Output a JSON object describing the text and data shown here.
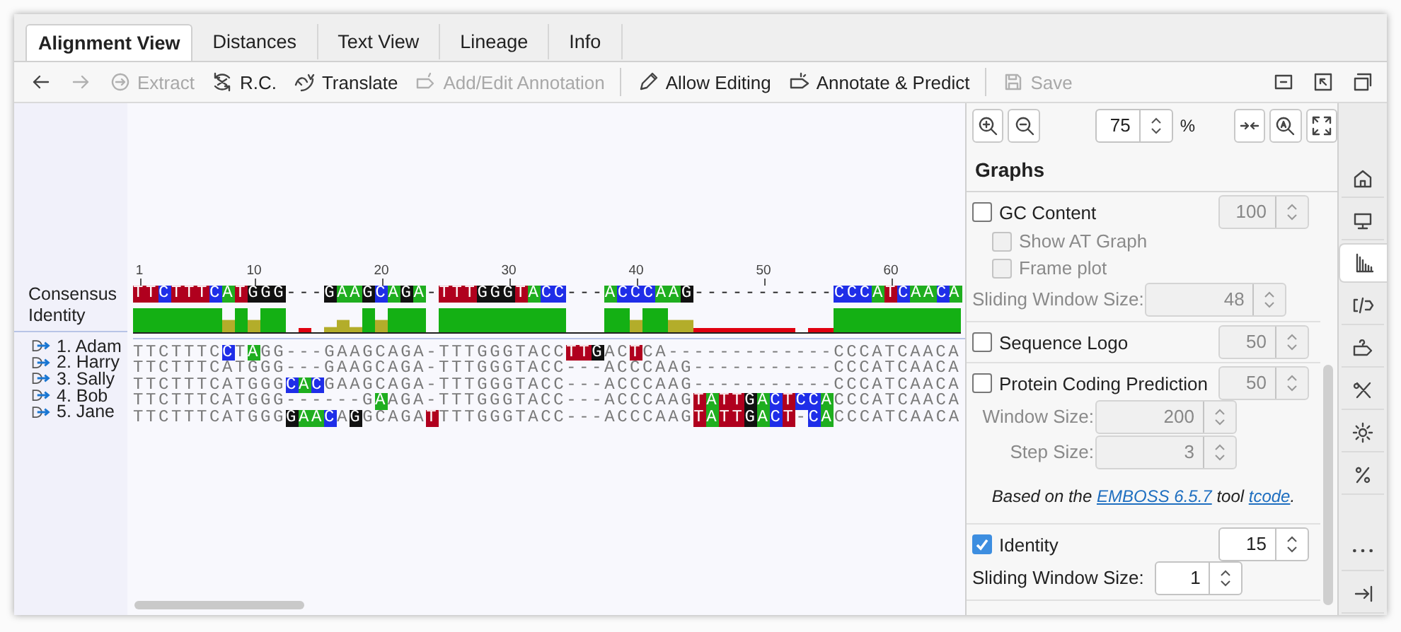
{
  "tabs": [
    {
      "label": "Alignment View",
      "selected": true
    },
    {
      "label": "Distances",
      "selected": false
    },
    {
      "label": "Text View",
      "selected": false
    },
    {
      "label": "Lineage",
      "selected": false
    },
    {
      "label": "Info",
      "selected": false
    }
  ],
  "toolbar": [
    {
      "kind": "back",
      "disabled": false
    },
    {
      "kind": "forward",
      "disabled": true
    },
    {
      "kind": "extract",
      "label": "Extract",
      "disabled": true
    },
    {
      "kind": "rc",
      "label": "R.C.",
      "disabled": false
    },
    {
      "kind": "translate",
      "label": "Translate",
      "disabled": false
    },
    {
      "kind": "annotation",
      "label": "Add/Edit Annotation",
      "disabled": true
    },
    {
      "kind": "separator"
    },
    {
      "kind": "edit",
      "label": "Allow Editing",
      "disabled": false
    },
    {
      "kind": "predict",
      "label": "Annotate & Predict",
      "disabled": false
    },
    {
      "kind": "separator"
    },
    {
      "kind": "save",
      "label": "Save",
      "disabled": true
    }
  ],
  "toolbar_right": [
    {
      "kind": "collapse"
    },
    {
      "kind": "popout"
    },
    {
      "kind": "windows"
    }
  ],
  "alignment": {
    "ruler": [
      "1",
      "10",
      "20",
      "30",
      "40",
      "50",
      "60"
    ],
    "consensus_label": "Consensus",
    "identity_label": "Identity",
    "consensus": [
      {
        "text": "TT",
        "color": "#b0001e"
      },
      {
        "text": "C",
        "color": "#1f2ee8"
      },
      {
        "text": "TTT",
        "color": "#b0001e"
      },
      {
        "text": "C",
        "color": "#1f2ee8"
      },
      {
        "text": "A",
        "color": "#1fae1f"
      },
      {
        "text": "T",
        "color": "#b0001e"
      },
      {
        "text": "GGG",
        "color": "#111111"
      },
      {
        "text": "---"
      },
      {
        "text": "G",
        "color": "#111111"
      },
      {
        "text": "AA",
        "color": "#1fae1f"
      },
      {
        "text": "G",
        "color": "#111111"
      },
      {
        "text": "C",
        "color": "#1f2ee8"
      },
      {
        "text": "A",
        "color": "#1fae1f"
      },
      {
        "text": "G",
        "color": "#111111"
      },
      {
        "text": "A",
        "color": "#1fae1f"
      },
      {
        "text": "-"
      },
      {
        "text": "TTT",
        "color": "#b0001e"
      },
      {
        "text": "GGG",
        "color": "#111111"
      },
      {
        "text": "T",
        "color": "#b0001e"
      },
      {
        "text": "A",
        "color": "#1fae1f"
      },
      {
        "text": "CC",
        "color": "#1f2ee8"
      },
      {
        "text": "---"
      },
      {
        "text": "A",
        "color": "#1fae1f"
      },
      {
        "text": "CCC",
        "color": "#1f2ee8"
      },
      {
        "text": "AA",
        "color": "#1fae1f"
      },
      {
        "text": "G",
        "color": "#111111"
      },
      {
        "text": "-----------"
      },
      {
        "text": "CCC",
        "color": "#1f2ee8"
      },
      {
        "text": "A",
        "color": "#1fae1f"
      },
      {
        "text": "T",
        "color": "#b0001e"
      },
      {
        "text": "C",
        "color": "#1f2ee8"
      },
      {
        "text": "AA",
        "color": "#1fae1f"
      },
      {
        "text": "C",
        "color": "#1f2ee8"
      },
      {
        "text": "A",
        "color": "#1fae1f"
      }
    ],
    "sequences": [
      {
        "name": "1. Adam",
        "segments": [
          {
            "text": "TTCTTTC"
          },
          {
            "text": "C",
            "color": "#1f2ee8"
          },
          {
            "text": "T"
          },
          {
            "text": "A",
            "color": "#1fae1f"
          },
          {
            "text": "GG---GAAGCAGA-TTTGGGTACC"
          },
          {
            "text": "TT",
            "color": "#b0001e"
          },
          {
            "text": "G",
            "color": "#111111"
          },
          {
            "text": "AC"
          },
          {
            "text": "T",
            "color": "#b0001e"
          },
          {
            "text": "CA-------------CCCATCAACA"
          }
        ]
      },
      {
        "name": "2. Harry",
        "segments": [
          {
            "text": "TTCTTTCATGGG---GAAGCAGA-TTTGGGTACC---ACCCAAG-----------CCCATCAACA"
          }
        ]
      },
      {
        "name": "3. Sally",
        "segments": [
          {
            "text": "TTCTTTCATGGG"
          },
          {
            "text": "C",
            "color": "#1f2ee8"
          },
          {
            "text": "A",
            "color": "#1fae1f"
          },
          {
            "text": "C",
            "color": "#1f2ee8"
          },
          {
            "text": "GAAGCAGA-TTTGGGTACC---ACCCAAG-----------CCCATCAACA"
          }
        ]
      },
      {
        "name": "4. Bob",
        "segments": [
          {
            "text": "TTCTTTCATGGG------G"
          },
          {
            "text": "A",
            "color": "#1fae1f"
          },
          {
            "text": "AGA-TTTGGGTACC---ACCCAAG"
          },
          {
            "text": "T",
            "color": "#b0001e"
          },
          {
            "text": "A",
            "color": "#1fae1f"
          },
          {
            "text": "TT",
            "color": "#b0001e"
          },
          {
            "text": "G",
            "color": "#111111"
          },
          {
            "text": "A",
            "color": "#1fae1f"
          },
          {
            "text": "C",
            "color": "#1f2ee8"
          },
          {
            "text": "T",
            "color": "#b0001e"
          },
          {
            "text": "CC",
            "color": "#1f2ee8"
          },
          {
            "text": "A",
            "color": "#1fae1f"
          },
          {
            "text": "CCCATCAACA"
          }
        ]
      },
      {
        "name": "5. Jane",
        "segments": [
          {
            "text": "TTCTTTCATGGG"
          },
          {
            "text": "G",
            "color": "#111111"
          },
          {
            "text": "AA",
            "color": "#1fae1f"
          },
          {
            "text": "C",
            "color": "#1f2ee8"
          },
          {
            "text": "A"
          },
          {
            "text": "G",
            "color": "#111111"
          },
          {
            "text": "GCAGA"
          },
          {
            "text": "T",
            "color": "#b0001e"
          },
          {
            "text": "TTTGGGTACC---ACCCAAG"
          },
          {
            "text": "T",
            "color": "#b0001e"
          },
          {
            "text": "A",
            "color": "#1fae1f"
          },
          {
            "text": "TT",
            "color": "#b0001e"
          },
          {
            "text": "G",
            "color": "#111111"
          },
          {
            "text": "A",
            "color": "#1fae1f"
          },
          {
            "text": "C",
            "color": "#1f2ee8"
          },
          {
            "text": "T",
            "color": "#b0001e"
          },
          {
            "text": "-"
          },
          {
            "text": "C",
            "color": "#1f2ee8"
          },
          {
            "text": "A",
            "color": "#1fae1f"
          },
          {
            "text": "CCCATCAACA"
          }
        ]
      }
    ]
  },
  "zoom": {
    "value": "75",
    "unit": "%"
  },
  "graphs": {
    "title": "Graphs",
    "sections": [
      [
        {
          "kind": "check",
          "label": "GC Content",
          "checked": false,
          "value": "100",
          "disabled": true
        },
        {
          "kind": "subcheck",
          "label": "Show AT Graph",
          "checked": false,
          "disabled": true
        },
        {
          "kind": "subcheck",
          "label": "Frame plot",
          "checked": false,
          "disabled": true
        },
        {
          "kind": "field",
          "label": "Sliding Window Size:",
          "value": "48",
          "disabled": true
        }
      ],
      [
        {
          "kind": "check",
          "label": "Sequence Logo",
          "checked": false,
          "value": "50",
          "disabled": true
        }
      ],
      [
        {
          "kind": "check",
          "label": "Protein Coding Prediction",
          "checked": false,
          "value": "50",
          "disabled": true
        },
        {
          "kind": "field",
          "label": "Window Size:",
          "value": "200",
          "disabled": true
        },
        {
          "kind": "field",
          "label": "Step Size:",
          "value": "3",
          "disabled": true
        },
        {
          "kind": "note",
          "parts": [
            {
              "text": "Based on the "
            },
            {
              "text": "EMBOSS 6.5.7",
              "link": true
            },
            {
              "text": " tool "
            },
            {
              "text": "tcode",
              "link": true
            },
            {
              "text": "."
            }
          ]
        }
      ],
      [
        {
          "kind": "check",
          "label": "Identity",
          "checked": true,
          "value": "15",
          "disabled": false
        },
        {
          "kind": "field",
          "label": "Sliding Window Size:",
          "value": "1",
          "disabled": false
        }
      ]
    ]
  },
  "side_tabs": [
    {
      "kind": "home",
      "selected": false
    },
    {
      "kind": "monitor",
      "selected": false
    },
    {
      "kind": "chart",
      "selected": true
    },
    {
      "kind": "code",
      "selected": false
    },
    {
      "kind": "question",
      "selected": false
    },
    {
      "kind": "scissors",
      "selected": false
    },
    {
      "kind": "gear",
      "selected": false
    },
    {
      "kind": "percent",
      "selected": false
    }
  ],
  "side_bottom": [
    {
      "kind": "more"
    },
    {
      "kind": "pin"
    }
  ]
}
